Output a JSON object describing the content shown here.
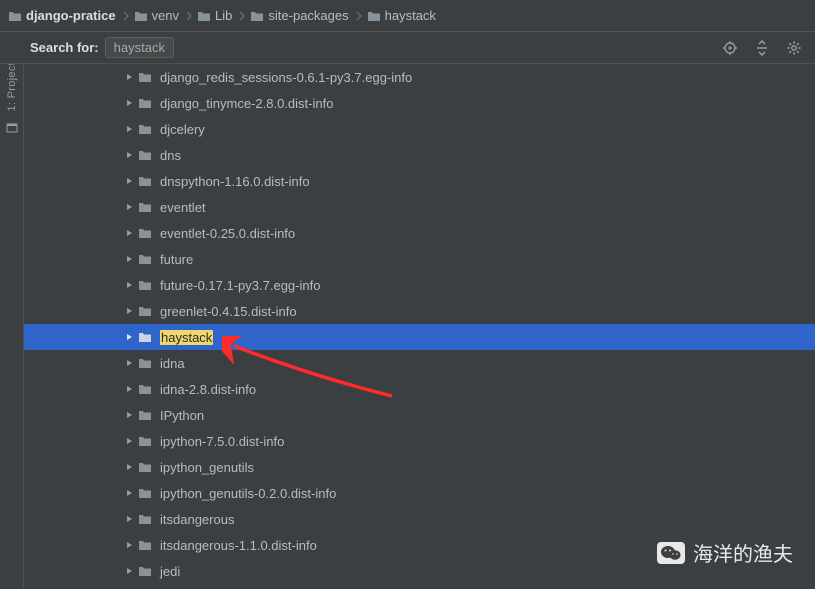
{
  "breadcrumb": [
    {
      "label": "django-pratice",
      "bold": true
    },
    {
      "label": "venv"
    },
    {
      "label": "Lib"
    },
    {
      "label": "site-packages"
    },
    {
      "label": "haystack"
    }
  ],
  "search": {
    "label": "Search for:",
    "query": "haystack"
  },
  "sidebar": {
    "label": "1: Project"
  },
  "tree": [
    {
      "name": "django_redis_sessions-0.6.1-py3.7.egg-info",
      "highlight": false,
      "selected": false
    },
    {
      "name": "django_tinymce-2.8.0.dist-info",
      "highlight": false,
      "selected": false
    },
    {
      "name": "djcelery",
      "highlight": false,
      "selected": false
    },
    {
      "name": "dns",
      "highlight": false,
      "selected": false
    },
    {
      "name": "dnspython-1.16.0.dist-info",
      "highlight": false,
      "selected": false
    },
    {
      "name": "eventlet",
      "highlight": false,
      "selected": false
    },
    {
      "name": "eventlet-0.25.0.dist-info",
      "highlight": false,
      "selected": false
    },
    {
      "name": "future",
      "highlight": false,
      "selected": false
    },
    {
      "name": "future-0.17.1-py3.7.egg-info",
      "highlight": false,
      "selected": false
    },
    {
      "name": "greenlet-0.4.15.dist-info",
      "highlight": false,
      "selected": false
    },
    {
      "name": "haystack",
      "highlight": true,
      "selected": true
    },
    {
      "name": "idna",
      "highlight": false,
      "selected": false
    },
    {
      "name": "idna-2.8.dist-info",
      "highlight": false,
      "selected": false
    },
    {
      "name": "IPython",
      "highlight": false,
      "selected": false
    },
    {
      "name": "ipython-7.5.0.dist-info",
      "highlight": false,
      "selected": false
    },
    {
      "name": "ipython_genutils",
      "highlight": false,
      "selected": false
    },
    {
      "name": "ipython_genutils-0.2.0.dist-info",
      "highlight": false,
      "selected": false
    },
    {
      "name": "itsdangerous",
      "highlight": false,
      "selected": false
    },
    {
      "name": "itsdangerous-1.1.0.dist-info",
      "highlight": false,
      "selected": false
    },
    {
      "name": "jedi",
      "highlight": false,
      "selected": false
    }
  ],
  "watermark": {
    "text": "海洋的渔夫"
  }
}
